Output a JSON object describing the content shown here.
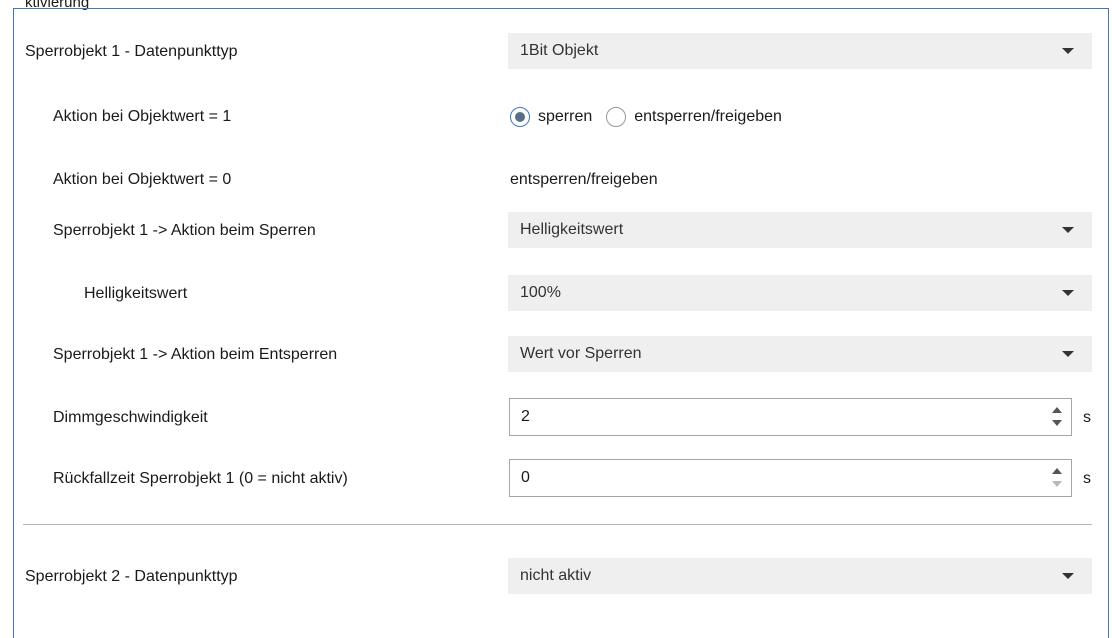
{
  "header_fragment": "ktivierung",
  "rows": [
    {
      "label": "Sperrobjekt 1 - Datenpunkttyp",
      "value": "1Bit Objekt"
    },
    {
      "label": "Aktion bei Objektwert = 1"
    },
    {
      "label": "Aktion bei Objektwert = 0",
      "value": "entsperren/freigeben"
    },
    {
      "label": "Sperrobjekt 1 -> Aktion beim Sperren",
      "value": "Helligkeitswert"
    },
    {
      "label": "Helligkeitswert",
      "value": "100%"
    },
    {
      "label": "Sperrobjekt 1 -> Aktion beim Entsperren",
      "value": "Wert vor Sperren"
    },
    {
      "label": "Dimmgeschwindigkeit",
      "value": "2",
      "unit": "s"
    },
    {
      "label": "Rückfallzeit Sperrobjekt 1 (0 = nicht aktiv)",
      "value": "0",
      "unit": "s"
    },
    {
      "label": "Sperrobjekt 2 - Datenpunkttyp",
      "value": "nicht aktiv"
    }
  ],
  "radio": {
    "options": [
      {
        "label": "sperren",
        "selected": true
      },
      {
        "label": "entsperren/freigeben",
        "selected": false
      }
    ]
  },
  "colors": {
    "frame_border": "#3f78b7",
    "select_bg": "#efefef",
    "divider": "#b4b4b4"
  }
}
